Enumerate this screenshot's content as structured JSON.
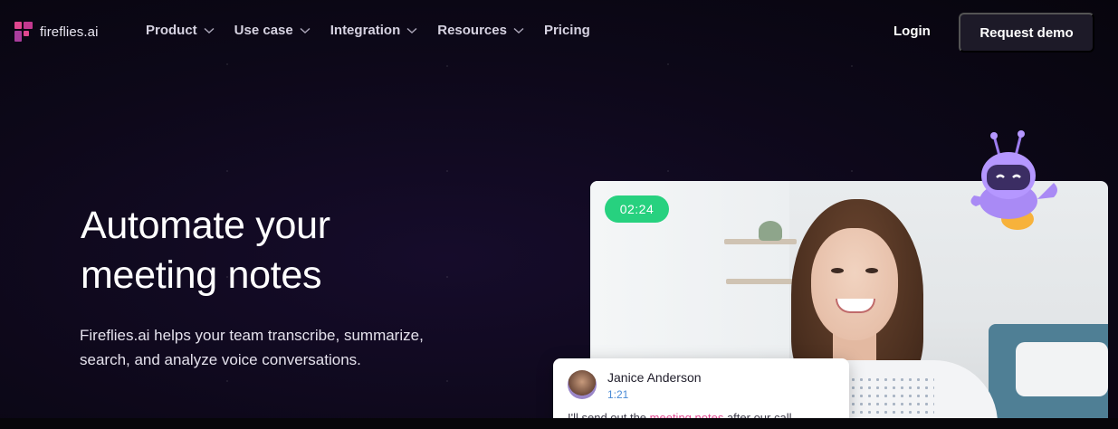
{
  "brand": {
    "name": "fireflies.ai",
    "accent": "#e0478f"
  },
  "nav": {
    "items": [
      {
        "label": "Product",
        "has_dropdown": true
      },
      {
        "label": "Use case",
        "has_dropdown": true
      },
      {
        "label": "Integration",
        "has_dropdown": true
      },
      {
        "label": "Resources",
        "has_dropdown": true
      },
      {
        "label": "Pricing",
        "has_dropdown": false
      }
    ],
    "login_label": "Login",
    "cta_label": "Request demo"
  },
  "hero": {
    "title_line1": "Automate your",
    "title_line2": "meeting notes",
    "subtitle_line1": "Fireflies.ai helps your team transcribe, summarize,",
    "subtitle_line2": "search, and analyze voice conversations."
  },
  "video": {
    "timer": "02:24",
    "timer_color": "#27d17f"
  },
  "transcript": {
    "speaker": "Janice Anderson",
    "timestamp": "1:21",
    "text_before": "I'll send out the ",
    "text_highlight": "meeting notes",
    "text_after": " after our call"
  }
}
